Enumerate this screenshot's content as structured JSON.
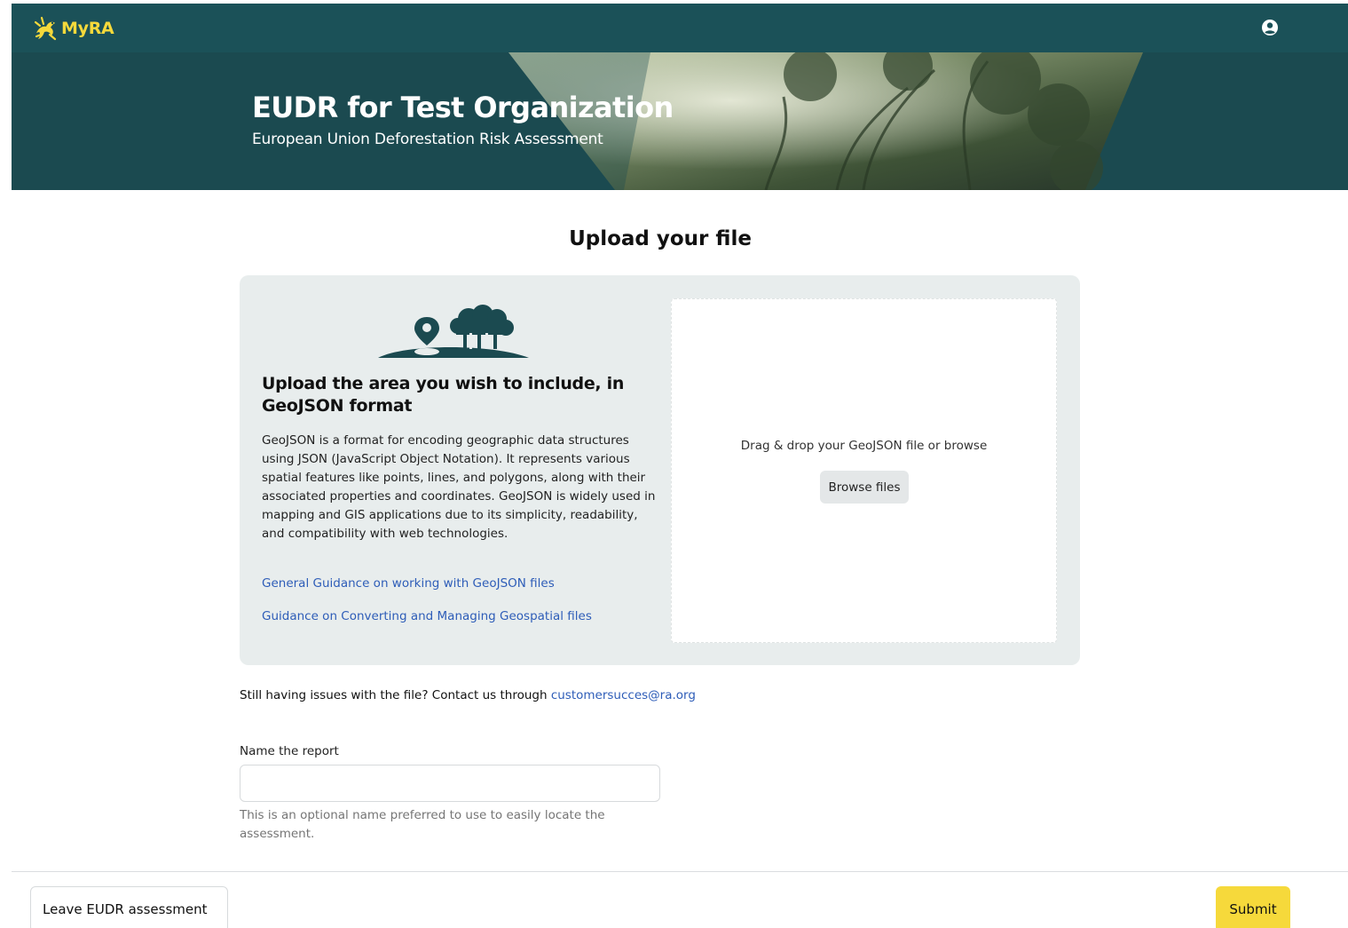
{
  "header": {
    "app_name": "MyRA",
    "logo_icon": "frog-logo-icon",
    "user_icon": "user-circle-icon",
    "brand_color": "#f6d93b",
    "bar_color": "#1b5158"
  },
  "hero": {
    "title": "EUDR for Test Organization",
    "subtitle": "European Union Deforestation Risk Assessment"
  },
  "upload": {
    "heading": "Upload your file",
    "illustration_icon": "map-pin-trees-icon",
    "info_title": "Upload the area you wish to include, in GeoJSON format",
    "info_body": "GeoJSON is a format for encoding geographic data structures using JSON (JavaScript Object Notation). It represents various spatial features like points, lines, and polygons, along with their associated properties and coordinates. GeoJSON is widely used in mapping and GIS applications due to its simplicity, readability, and compatibility with web technologies.",
    "links": [
      "General Guidance on working with GeoJSON files",
      "Guidance on Converting and Managing Geospatial files"
    ],
    "dropzone_text": "Drag & drop your GeoJSON file or browse",
    "browse_label": "Browse files"
  },
  "help": {
    "text": "Still having issues with the file? Contact us through ",
    "email": "customersucces@ra.org",
    "link_color": "#2e5db8"
  },
  "report_name": {
    "label": "Name the report",
    "value": "",
    "hint": "This is an optional name preferred to use to easily locate the assessment."
  },
  "footer": {
    "leave_label": "Leave EUDR assessment",
    "submit_label": "Submit",
    "submit_color": "#f6d93b"
  }
}
